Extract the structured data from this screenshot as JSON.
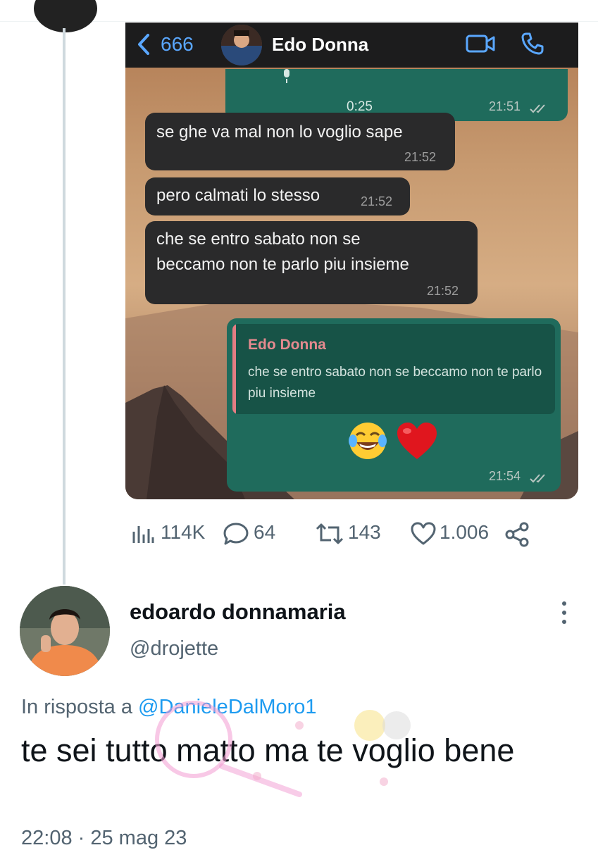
{
  "chat": {
    "back_count": "666",
    "contact_name": "Edo Donna",
    "audio": {
      "duration": "0:25",
      "time": "21:51"
    },
    "messages": [
      {
        "text": "se ghe va mal non lo voglio sape",
        "time": "21:52"
      },
      {
        "text": "pero calmati lo stesso",
        "time": "21:52"
      },
      {
        "text": "che se entro sabato non se\nbeccamo non te parlo piu insieme",
        "time": "21:52"
      }
    ],
    "reply": {
      "quoted_name": "Edo Donna",
      "quoted_text": "che se entro sabato non se beccamo non te parlo piu insieme",
      "emojis": [
        "face-with-tears-of-joy-icon",
        "red-heart-icon"
      ],
      "time": "21:54"
    }
  },
  "metrics": {
    "views": "114K",
    "replies": "64",
    "retweets": "143",
    "likes": "1.006"
  },
  "reply_tweet": {
    "display_name": "edoardo donnamaria",
    "handle": "@drojette",
    "reply_prefix": "In risposta a ",
    "reply_mention": "@DanieleDalMoro1",
    "text": "te sei tutto matto ma te voglio bene",
    "timestamp": "22:08 · 25 mag 23"
  },
  "colors": {
    "chat_outgoing": "#1f6b5c",
    "chat_incoming": "#2a2a2b",
    "mention": "#1d9bf0",
    "secondary_text": "#536471"
  }
}
